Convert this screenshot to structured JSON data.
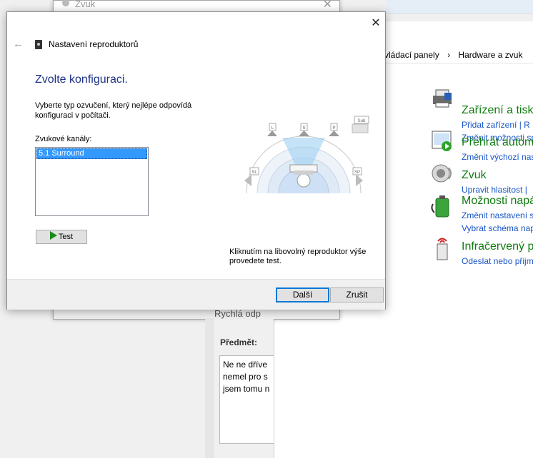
{
  "zvuk_window": {
    "title": "Zvuk",
    "close_glyph": "✕"
  },
  "control_panel": {
    "breadcrumb": [
      "vládací panely",
      "Hardware a zvuk"
    ],
    "crumb_sep": "›",
    "items": [
      {
        "title": "Zařízení a tiská",
        "links": [
          "Přidat zařízení  |  R",
          "Změnit možnosti sp"
        ],
        "icon": "printer-icon"
      },
      {
        "title": "Přehrát autom",
        "links": [
          "Změnit výchozí nas"
        ],
        "icon": "autoplay-icon"
      },
      {
        "title": "Zvuk",
        "links": [
          "Upravit hlasitost  |"
        ],
        "icon": "speaker-icon"
      },
      {
        "title": "Možnosti napá",
        "links": [
          "Změnit nastavení sp",
          "Vybrat schéma nap"
        ],
        "icon": "battery-icon"
      },
      {
        "title": "Infračervený p",
        "links": [
          "Odeslat nebo přijm"
        ],
        "icon": "infrared-icon"
      }
    ]
  },
  "mail": {
    "heading_partial": "Rychlá odp",
    "subject_label": "Předmět:",
    "body_lines": [
      "Ne ne dříve",
      "nemel pro  s",
      "jsem tomu n"
    ]
  },
  "dialog": {
    "close_glyph": "✕",
    "back_glyph": "←",
    "title": "Nastavení reproduktorů",
    "heading": "Zvolte konfiguraci.",
    "description": "Vyberte typ ozvučení, který nejlépe odpovídá konfiguraci v počítači.",
    "channels_label": "Zvukové kanály:",
    "channels": [
      "5.1 Surround"
    ],
    "test_label": "Test",
    "hint": "Kliknutím na libovolný reproduktor výše provedete test.",
    "next_label": "Další",
    "cancel_label": "Zrušit",
    "speaker_labels": {
      "l": "L",
      "c": "S",
      "r": "P",
      "sub": "Sub",
      "sl": "SL",
      "sr": "SP"
    }
  },
  "colors": {
    "heading_blue": "#1e3287",
    "cp_green": "#107c10",
    "cp_link": "#1a56c8",
    "selection": "#3399ff",
    "focus_border": "#0078d7"
  }
}
